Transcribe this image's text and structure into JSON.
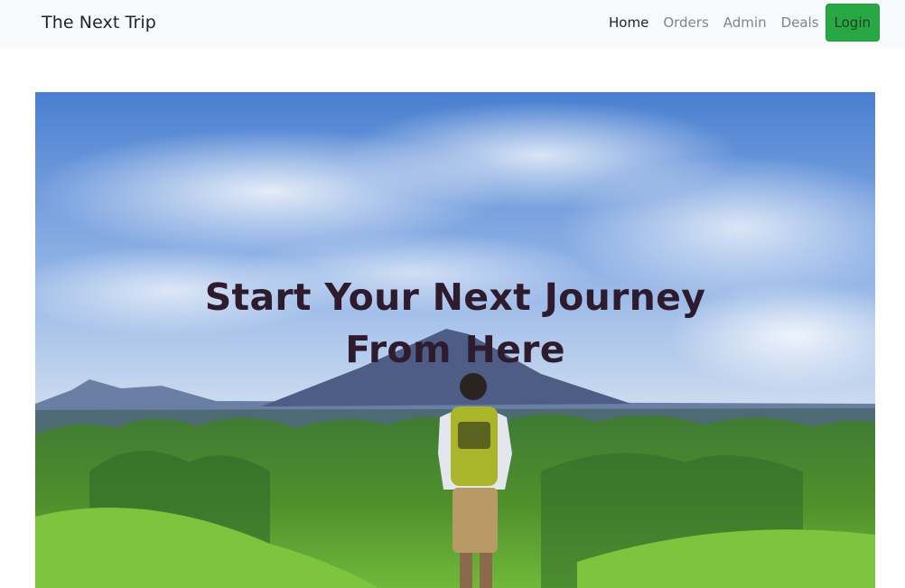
{
  "navbar": {
    "brand": "The Next Trip",
    "links": [
      {
        "label": "Home",
        "active": true
      },
      {
        "label": "Orders",
        "active": false
      },
      {
        "label": "Admin",
        "active": false
      },
      {
        "label": "Deals",
        "active": false
      }
    ],
    "login_label": "Login"
  },
  "hero": {
    "title_line1": "Start Your Next Journey",
    "title_line2": "From Here"
  },
  "colors": {
    "navbar_bg": "#f8f9fa",
    "login_bg": "#28a745",
    "title_color": "#2e1b2e",
    "link_muted": "#808488"
  }
}
